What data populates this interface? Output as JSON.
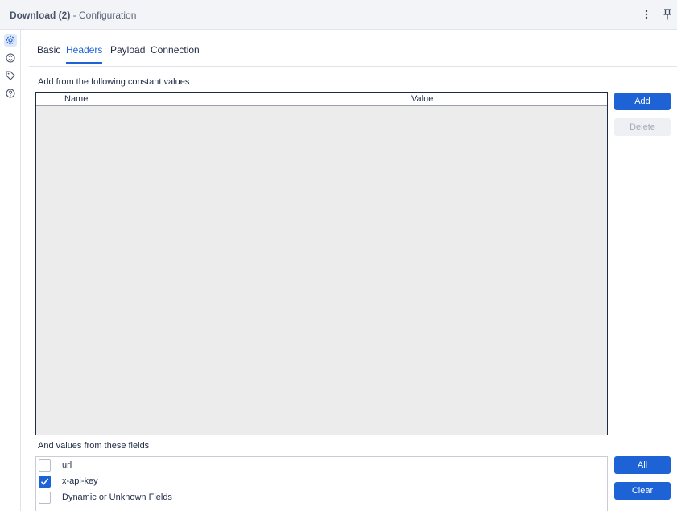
{
  "window": {
    "title_bold": "Download (2)",
    "title_rest": " - Configuration",
    "more_icon": "kebab-menu-icon",
    "pin_icon": "pin-icon"
  },
  "sidebar": {
    "items": [
      {
        "icon": "gear-icon",
        "active": true
      },
      {
        "icon": "circle-arrows-icon",
        "active": false
      },
      {
        "icon": "tag-icon",
        "active": false
      },
      {
        "icon": "help-icon",
        "active": false
      }
    ]
  },
  "tabs": [
    {
      "label": "Basic",
      "active": false
    },
    {
      "label": "Headers",
      "active": true
    },
    {
      "label": "Payload",
      "active": false
    },
    {
      "label": "Connection",
      "active": false
    }
  ],
  "constants": {
    "section_label": "Add from the following constant values",
    "columns": [
      "Name",
      "Value"
    ],
    "add_label": "Add",
    "delete_label": "Delete"
  },
  "fields": {
    "section_label": "And values from these fields",
    "items": [
      {
        "label": "url",
        "checked": false
      },
      {
        "label": "x-api-key",
        "checked": true
      },
      {
        "label": "Dynamic or Unknown Fields",
        "checked": false
      }
    ],
    "all_label": "All",
    "clear_label": "Clear"
  },
  "colors": {
    "accent": "#1d63d6",
    "grid_background": "#ececed",
    "titlebar": "#f3f4f7"
  }
}
